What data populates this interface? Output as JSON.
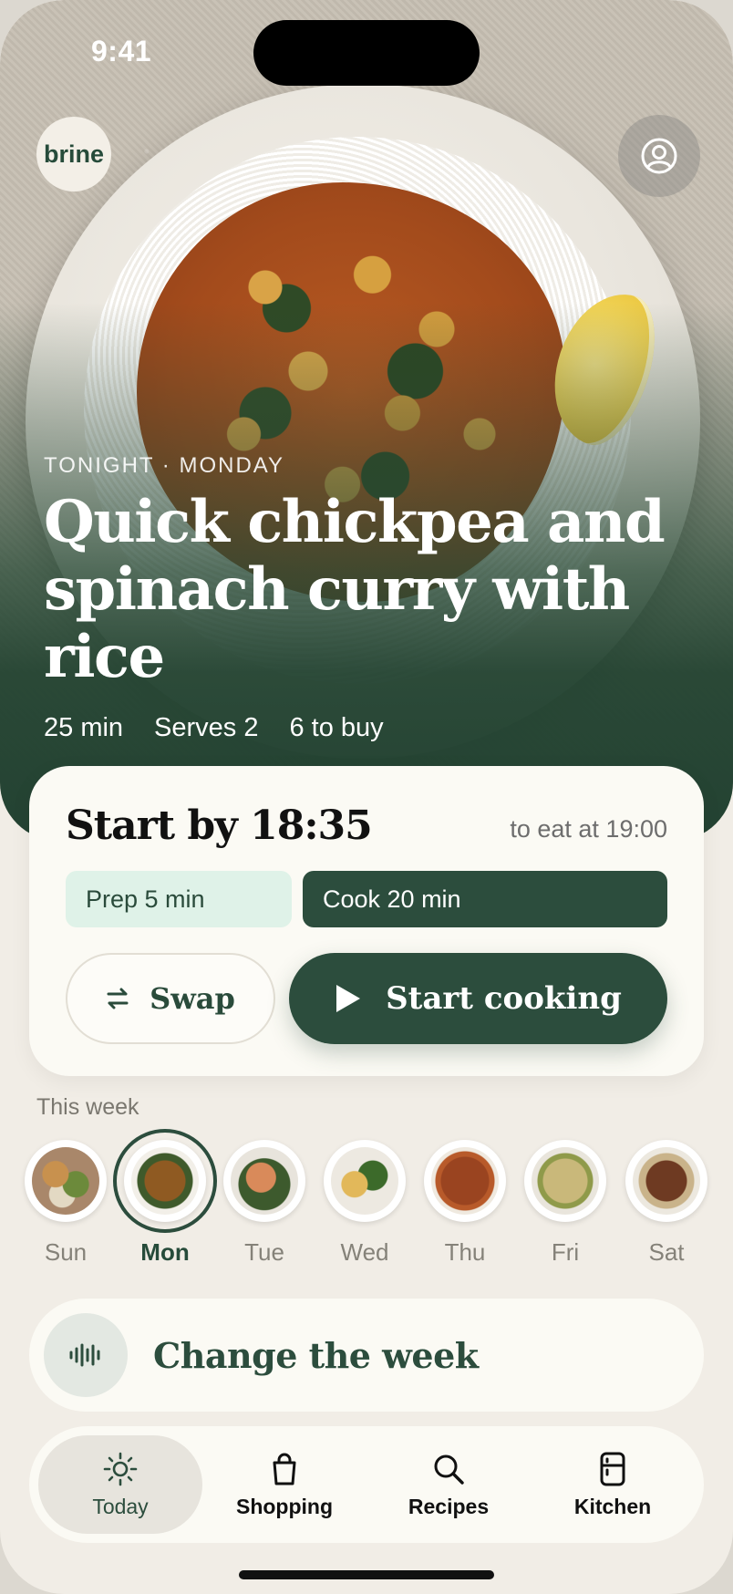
{
  "status_bar": {
    "time": "9:41"
  },
  "brand": {
    "logo_text": "brine"
  },
  "hero": {
    "eyebrow": "TONIGHT · MONDAY",
    "title": "Quick chickpea and spinach curry with rice",
    "meta": [
      "25 min",
      "Serves 2",
      "6 to buy"
    ]
  },
  "start_card": {
    "title": "Start by 18:35",
    "eat_at": "to eat at 19:00",
    "prep": "Prep 5 min",
    "cook": "Cook 20 min",
    "swap_label": "Swap",
    "start_label": "Start cooking"
  },
  "week": {
    "label": "This week",
    "days": [
      {
        "label": "Sun",
        "active": false,
        "food": "roast-dinner"
      },
      {
        "label": "Mon",
        "active": true,
        "food": "chickpea-curry"
      },
      {
        "label": "Tue",
        "active": false,
        "food": "salmon-greens"
      },
      {
        "label": "Wed",
        "active": false,
        "food": "frittata-salad"
      },
      {
        "label": "Thu",
        "active": false,
        "food": "sausage-stew"
      },
      {
        "label": "Fri",
        "active": false,
        "food": "grain-salad"
      },
      {
        "label": "Sat",
        "active": false,
        "food": "braised-meat"
      }
    ]
  },
  "change_week": {
    "label": "Change the week",
    "icon": "voice-waveform-icon"
  },
  "tabbar": {
    "items": [
      {
        "label": "Today",
        "icon": "sun-icon",
        "active": true
      },
      {
        "label": "Shopping",
        "icon": "bag-icon",
        "active": false
      },
      {
        "label": "Recipes",
        "icon": "search-icon",
        "active": false
      },
      {
        "label": "Kitchen",
        "icon": "fridge-icon",
        "active": false
      }
    ]
  },
  "colors": {
    "primary": "#2c4d3d",
    "background": "#f1ede6",
    "card": "#fbfaf4",
    "prep_pill": "#dff2e8"
  }
}
